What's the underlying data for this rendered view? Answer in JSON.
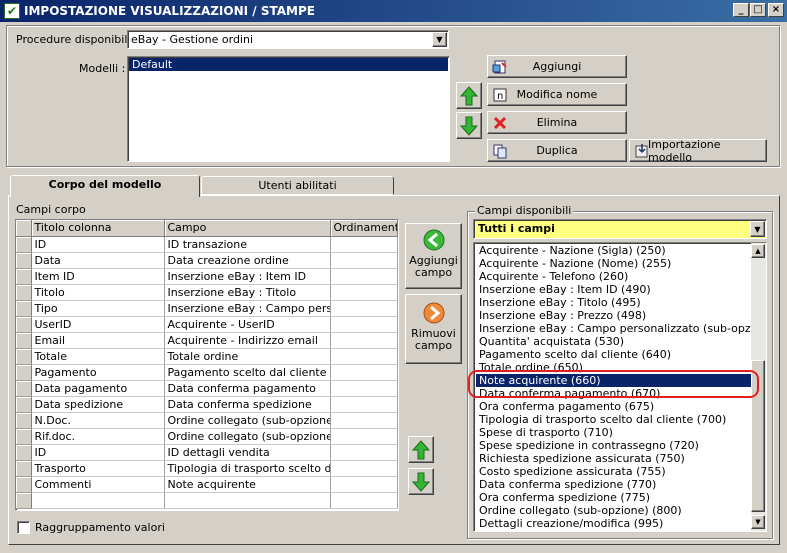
{
  "window": {
    "title": "IMPOSTAZIONE VISUALIZZAZIONI / STAMPE",
    "minimize": "_",
    "maximize": "□",
    "close": "×"
  },
  "top": {
    "procedure_label": "Procedure disponibili :",
    "procedure_value": "eBay - Gestione ordini",
    "models_label": "Modelli :",
    "models": [
      "Default"
    ],
    "buttons": {
      "add": "Aggiungi",
      "rename": "Modifica nome",
      "delete": "Elimina",
      "duplicate": "Duplica",
      "import": "Importazione modello"
    }
  },
  "tabs": [
    {
      "label": "Corpo del modello",
      "active": true
    },
    {
      "label": "Utenti abilitati",
      "active": false
    }
  ],
  "body": {
    "group_label": "Campi corpo",
    "columns": [
      "Titolo colonna",
      "Campo",
      "Ordinamento"
    ],
    "rows": [
      [
        "ID",
        "ID transazione",
        ""
      ],
      [
        "Data",
        "Data creazione ordine",
        ""
      ],
      [
        "Item ID",
        "Inserzione eBay : Item ID",
        ""
      ],
      [
        "Titolo",
        "Inserzione eBay : Titolo",
        ""
      ],
      [
        "Tipo",
        "Inserzione eBay : Campo person...",
        ""
      ],
      [
        "UserID",
        "Acquirente - UserID",
        ""
      ],
      [
        "Email",
        "Acquirente - Indirizzo email",
        ""
      ],
      [
        "Totale",
        "Totale ordine",
        ""
      ],
      [
        "Pagamento",
        "Pagamento scelto dal cliente",
        ""
      ],
      [
        "Data pagamento",
        "Data conferma pagamento",
        ""
      ],
      [
        "Data spedizione",
        "Data conferma spedizione",
        ""
      ],
      [
        "N.Doc.",
        "Ordine collegato (sub-opzione)",
        ""
      ],
      [
        "Rif.doc.",
        "Ordine collegato (sub-opzione)",
        ""
      ],
      [
        "ID",
        "ID dettagli vendita",
        ""
      ],
      [
        "Trasporto",
        "Tipologia di trasporto scelto dal ...",
        ""
      ],
      [
        "Commenti",
        "Note acquirente",
        ""
      ],
      [
        "",
        "",
        ""
      ]
    ],
    "add_field": "Aggiungi campo",
    "remove_field": "Rimuovi campo",
    "grouping_label": "Raggruppamento valori"
  },
  "available": {
    "group_label": "Campi disponibili",
    "filter_value": "Tutti i campi",
    "selected_index": 10,
    "items": [
      "Acquirente - Nazione (Sigla) (250)",
      "Acquirente - Nazione (Nome) (255)",
      "Acquirente - Telefono (260)",
      "Inserzione eBay : Item ID (490)",
      "Inserzione eBay : Titolo (495)",
      "Inserzione eBay : Prezzo (498)",
      "Inserzione eBay : Campo personalizzato (sub-opzione) (500)",
      "Quantita' acquistata (530)",
      "Pagamento scelto dal cliente (640)",
      "Totale ordine (650)",
      "Note acquirente (660)",
      "Data conferma pagamento (670)",
      "Ora conferma pagamento (675)",
      "Tipologia di trasporto scelto dal cliente (700)",
      "Spese di trasporto (710)",
      "Spese spedizione in contrassegno (720)",
      "Richiesta spedizione assicurata (750)",
      "Costo spedizione assicurata (755)",
      "Data conferma spedizione (770)",
      "Ora conferma spedizione (775)",
      "Ordine collegato (sub-opzione) (800)",
      "Dettagli creazione/modifica (995)"
    ]
  },
  "colors": {
    "highlight": "#0a246a",
    "annotation": "#e02020",
    "filter_bg": "#ffff80",
    "arrow_green": "#2fa32f"
  }
}
